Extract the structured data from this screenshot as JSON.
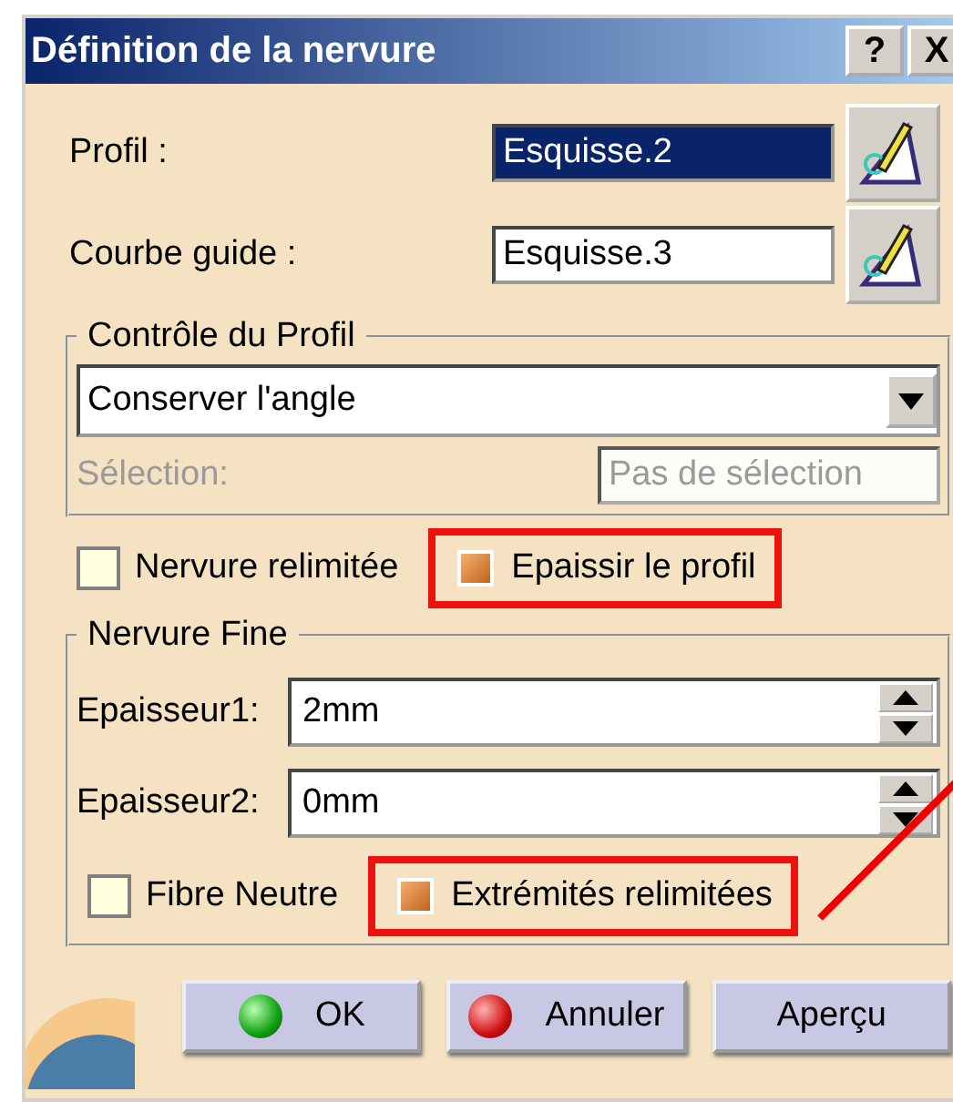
{
  "window": {
    "title": "Définition de la nervure",
    "title_buttons": [
      "?",
      "X"
    ]
  },
  "fields": [
    {
      "label": "Profil :",
      "value": "Esquisse.2",
      "selected": true
    },
    {
      "label": "Courbe guide :",
      "value": "Esquisse.3",
      "selected": false
    }
  ],
  "profile_control": {
    "title": "Contrôle du Profil",
    "dropdown": "Conserver l'angle",
    "selection": {
      "label": "Sélection:",
      "value": "Pas de sélection",
      "disabled": true
    }
  },
  "options": [
    {
      "label": "Nervure relimitée",
      "checked": false,
      "highlighted": false
    },
    {
      "label": "Epaissir le profil",
      "checked": true,
      "highlighted": true
    }
  ],
  "thin_rib": {
    "title": "Nervure Fine",
    "spinners": [
      {
        "label": "Epaisseur1:",
        "value": "2mm"
      },
      {
        "label": "Epaisseur2:",
        "value": "0mm"
      }
    ],
    "options": [
      {
        "label": "Fibre Neutre",
        "checked": false,
        "highlighted": false
      },
      {
        "label": "Extrémités relimitées",
        "checked": true,
        "highlighted": true
      }
    ]
  },
  "buttons": [
    {
      "label": "OK",
      "kind": "ok"
    },
    {
      "label": "Annuler",
      "kind": "cancel"
    },
    {
      "label": "Aperçu",
      "kind": "plain"
    }
  ]
}
